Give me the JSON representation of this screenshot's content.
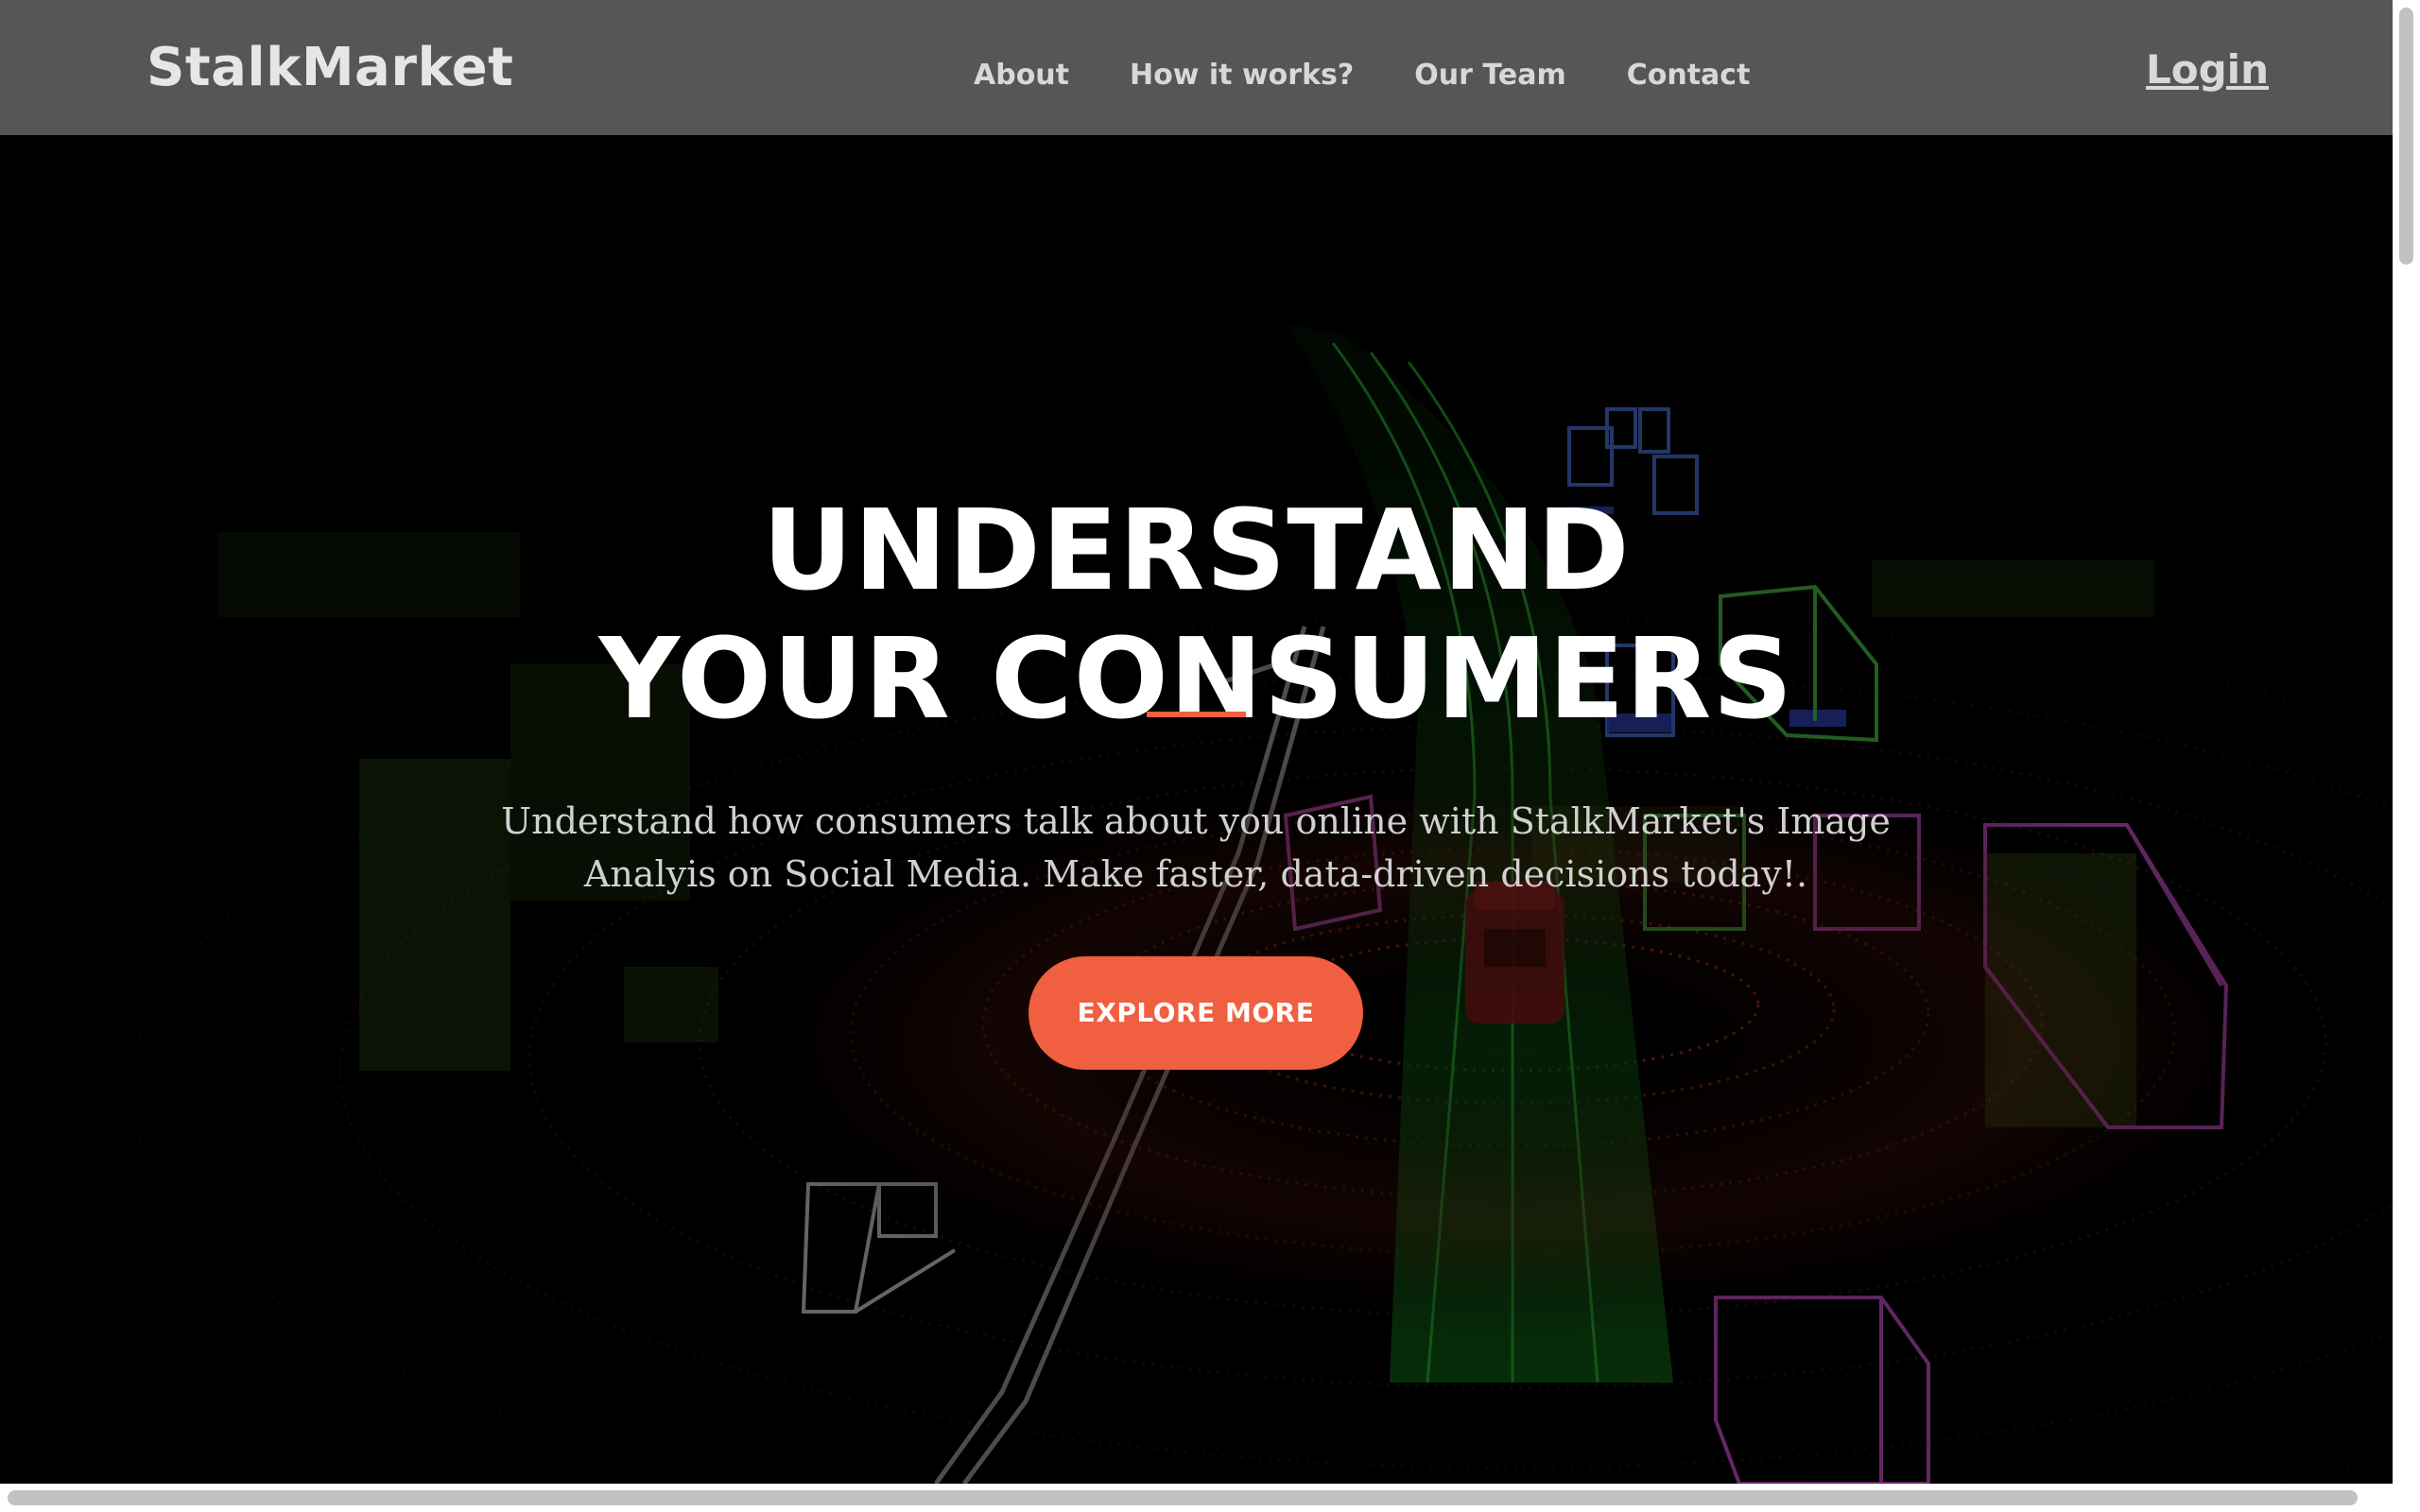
{
  "header": {
    "brand": "StalkMarket",
    "nav": [
      "About",
      "How it works?",
      "Our Team",
      "Contact"
    ],
    "login": "Login"
  },
  "hero": {
    "title_line1": "UNDERSTAND",
    "title_line2": "YOUR CONSUMERS",
    "subtitle": "Understand how consumers talk about you online with StalkMarket's Image Analyis on Social Media. Make faster, data-driven decisions today!.",
    "cta": "EXPLORE MORE"
  },
  "colors": {
    "navbar": "#565656",
    "accent": "#f05f40",
    "hero_background": "#000000"
  },
  "icons": {
    "hero_background": "lidar-point-cloud-image"
  }
}
